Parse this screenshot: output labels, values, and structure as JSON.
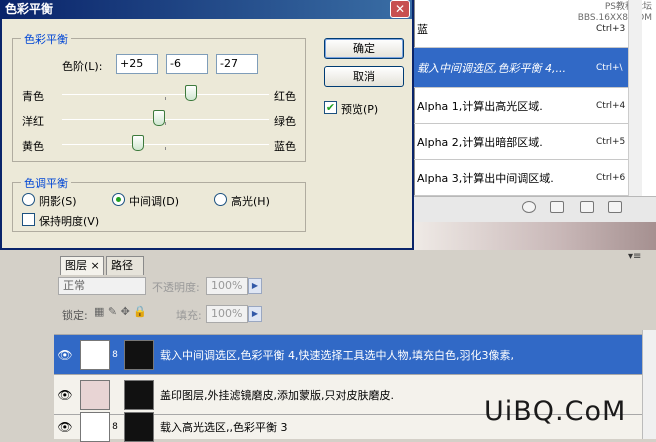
{
  "watermark": {
    "line1": "PS教程论坛",
    "line2": "BBS.16XX8.COM"
  },
  "channels": {
    "rows": [
      {
        "label": "蓝",
        "shortcut": "Ctrl+3",
        "selected": false
      },
      {
        "label": "载入中间调选区,色彩平衡 4,...",
        "shortcut": "Ctrl+\\",
        "selected": true
      },
      {
        "label": "Alpha 1,计算出高光区域.",
        "shortcut": "Ctrl+4",
        "selected": false
      },
      {
        "label": "Alpha 2,计算出暗部区域.",
        "shortcut": "Ctrl+5",
        "selected": false
      },
      {
        "label": "Alpha 3,计算出中间调区域.",
        "shortcut": "Ctrl+6",
        "selected": false
      }
    ]
  },
  "dialog": {
    "title": "色彩平衡",
    "close": "✕",
    "color_balance": {
      "legend": "色彩平衡",
      "levels_label": "色阶(L):",
      "levels": [
        "+25",
        "-6",
        "-27"
      ],
      "sliders": [
        {
          "left": "青色",
          "right": "红色",
          "value": 25
        },
        {
          "left": "洋红",
          "right": "绿色",
          "value": -6
        },
        {
          "left": "黄色",
          "right": "蓝色",
          "value": -27
        }
      ]
    },
    "tone_balance": {
      "legend": "色调平衡",
      "options": [
        "阴影(S)",
        "中间调(D)",
        "高光(H)"
      ],
      "selected": "中间调(D)",
      "preserve_luminosity": "保持明度(V)",
      "preserve_checked": false
    },
    "buttons": {
      "ok": "确定",
      "cancel": "取消"
    },
    "preview_label": "预览(P)",
    "preview_checked": true
  },
  "layers": {
    "tabs": [
      "图层",
      "路径"
    ],
    "tab_close": "×",
    "menu": "▾≡",
    "blend_mode": "正常",
    "opacity_label": "不透明度:",
    "opacity_value": "100%",
    "lock_label": "锁定:",
    "fill_label": "填充:",
    "fill_value": "100%",
    "rows": [
      {
        "name": "载入中间调选区,色彩平衡 4,快速选择工具选中人物,填充白色,羽化3像素,",
        "selected": true
      },
      {
        "name": "盖印图层,外挂滤镜磨皮,添加蒙版,只对皮肤磨皮.",
        "selected": false
      },
      {
        "name": "载入高光选区,,色彩平衡 3",
        "selected": false
      }
    ]
  },
  "brand": "UiBQ.CoM"
}
